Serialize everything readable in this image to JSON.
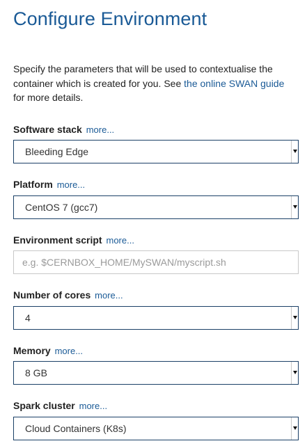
{
  "page": {
    "title": "Configure Environment",
    "intro_text": "Specify the parameters that will be used to contextualise the container which is created for you. See ",
    "intro_link": "the online SWAN guide",
    "intro_suffix": " for more details."
  },
  "fields": {
    "software_stack": {
      "label": "Software stack",
      "more": "more...",
      "value": "Bleeding Edge"
    },
    "platform": {
      "label": "Platform",
      "more": "more...",
      "value": "CentOS 7 (gcc7)"
    },
    "environment_script": {
      "label": "Environment script",
      "more": "more...",
      "placeholder": "e.g. $CERNBOX_HOME/MySWAN/myscript.sh"
    },
    "cores": {
      "label": "Number of cores",
      "more": "more...",
      "value": "4"
    },
    "memory": {
      "label": "Memory",
      "more": "more...",
      "value": "8 GB"
    },
    "spark_cluster": {
      "label": "Spark cluster",
      "more": "more...",
      "value": "Cloud Containers (K8s)"
    }
  },
  "colors": {
    "accent": "#1a5a96",
    "control_border": "#1a3f66",
    "placeholder": "#9a9a9a"
  }
}
